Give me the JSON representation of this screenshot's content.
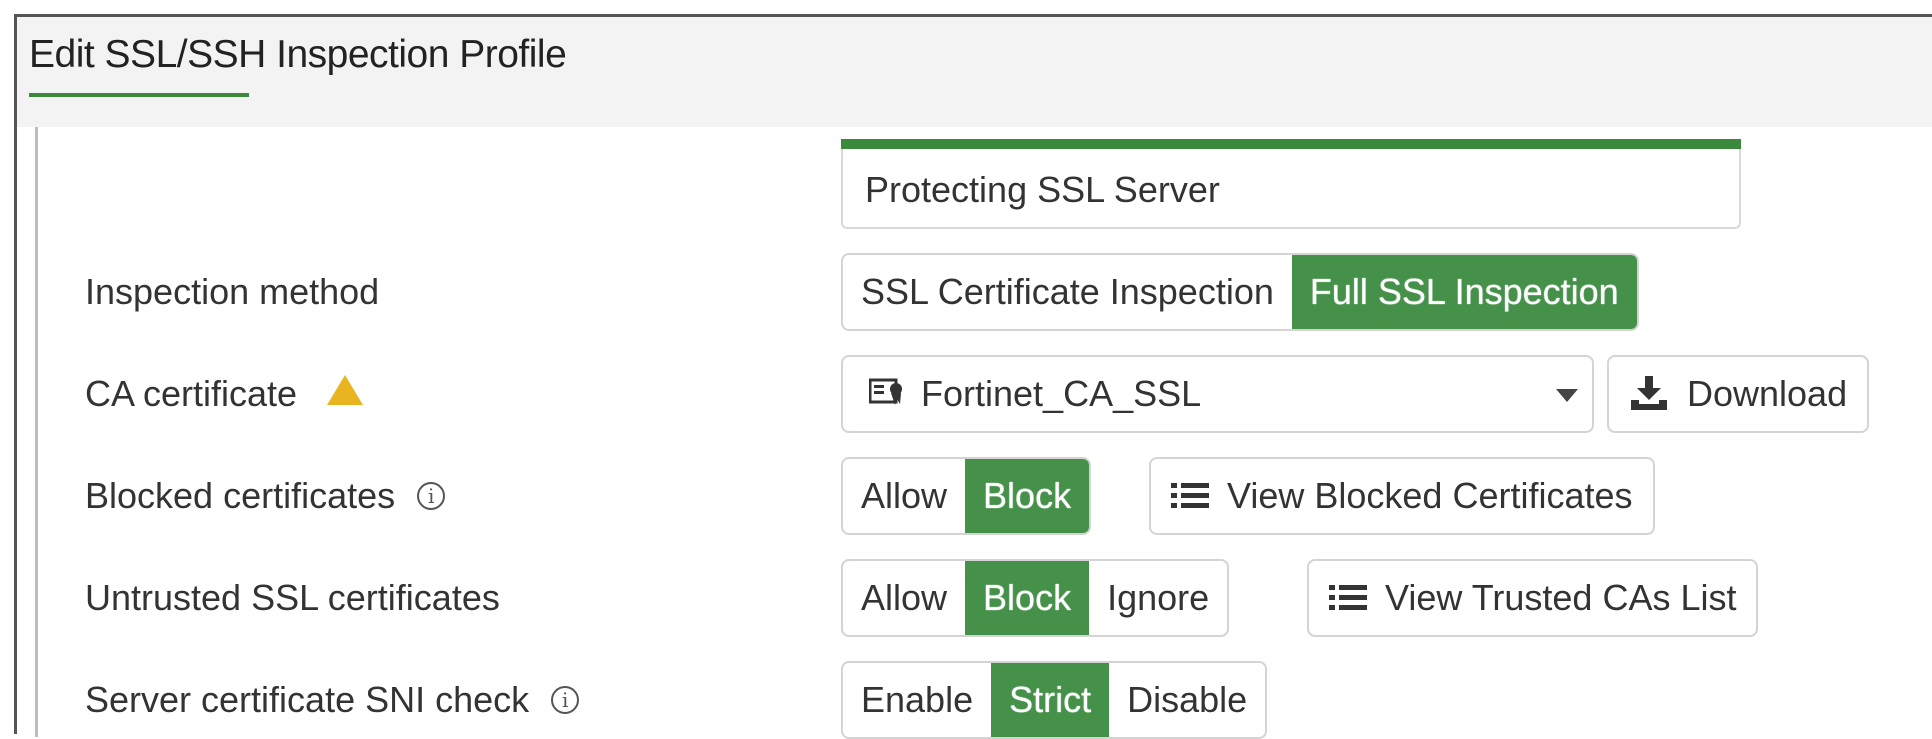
{
  "window": {
    "title": "Edit SSL/SSH Inspection Profile"
  },
  "profile": {
    "name_value": "Protecting SSL Server"
  },
  "colors": {
    "accent": "#45914a",
    "warning": "#e8b420"
  },
  "rows": {
    "inspection_method": {
      "label": "Inspection method",
      "options": [
        "SSL Certificate Inspection",
        "Full SSL Inspection"
      ],
      "selected": "Full SSL Inspection"
    },
    "ca_certificate": {
      "label": "CA certificate",
      "icon": "warning-icon",
      "value": "Fortinet_CA_SSL",
      "download_label": "Download"
    },
    "blocked_certificates": {
      "label": "Blocked certificates",
      "options": [
        "Allow",
        "Block"
      ],
      "selected": "Block",
      "view_label": "View Blocked Certificates"
    },
    "untrusted_ssl": {
      "label": "Untrusted SSL certificates",
      "options": [
        "Allow",
        "Block",
        "Ignore"
      ],
      "selected": "Block",
      "view_label": "View Trusted CAs List"
    },
    "sni_check": {
      "label": "Server certificate SNI check",
      "options": [
        "Enable",
        "Strict",
        "Disable"
      ],
      "selected": "Strict"
    }
  }
}
